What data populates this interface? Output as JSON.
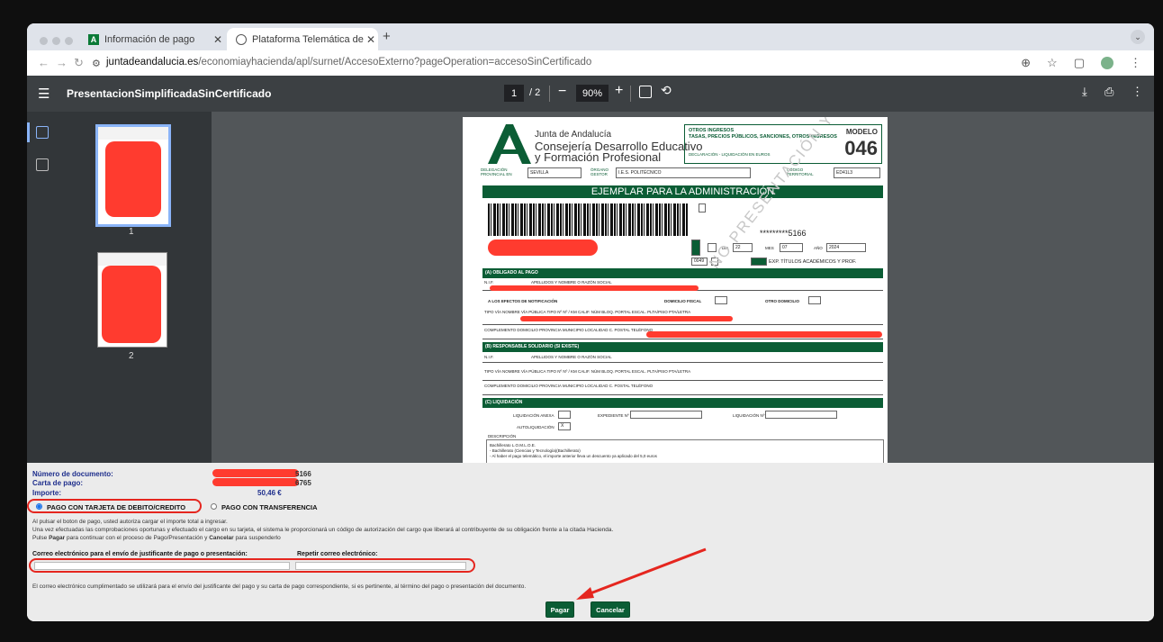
{
  "browser": {
    "tabs": [
      {
        "title": "Información de pago"
      },
      {
        "title": "Plataforma Telemática de Pa"
      }
    ],
    "url_host": "juntadeandalucia.es",
    "url_path": "/economiayhacienda/apl/surnet/AccesoExterno?pageOperation=accesoSinCertificado"
  },
  "pdf": {
    "title": "PresentacionSimplificadaSinCertificado",
    "current_page": "1",
    "total_pages": "/ 2",
    "zoom": "90%",
    "thumbnails": [
      {
        "label": "1"
      },
      {
        "label": "2"
      }
    ]
  },
  "document": {
    "org": "Junta de Andalucía",
    "dept": "Consejería Desarrollo Educativo y Formación Profesional",
    "category": "OTROS INGRESOS",
    "category_sub": "TASAS, PRECIOS PÚBLICOS, SANCIONES, OTROS INGRESOS",
    "modelo_label": "MODELO",
    "modelo_number": "046",
    "declaration": "DECLARACIÓN - LIQUIDACIÓN EN EUROS",
    "delegacion_label": "DELEGACIÓN PROVINCIAL EN",
    "delegacion_value": "SEVILLA",
    "organo_label": "ÓRGANO GESTOR",
    "organo_value": "I.E.S. POLITÉCNICO",
    "codigo_label": "CÓDIGO TERRITORIAL",
    "codigo_value": "ED41L3",
    "banner": "EJEMPLAR PARA LA ADMINISTRACIÓN",
    "doc_number": "*********5166",
    "date_day_label": "DIA",
    "date_day": "22",
    "date_month_label": "MES",
    "date_month": "07",
    "date_year_label": "AÑO",
    "date_year": "2024",
    "concept_code": "0049",
    "concept_text": "EXP. TÍTULOS ACADÉMICOS Y PROF.",
    "section_a": "(A) OBLIGADO AL PAGO",
    "nif_label": "N.I.F.",
    "name_label": "APELLIDOS Y NOMBRE O RAZÓN SOCIAL",
    "notif_label": "A LOS EFECTOS DE NOTIFICACIÓN",
    "domicilio_fiscal": "DOMICILIO FISCAL",
    "otro_domicilio": "OTRO DOMICILIO",
    "address_labels": "TIPO VÍA   NOMBRE VÍA PÚBLICA                                   TIPO Nº  Nº / KM  CALIF. NÚM  BLOQ.  PORTAL  ESCAL.  PLTA/PISO  PTA/LETRA",
    "address_labels2": "COMPLEMENTO DOMICILIO                 PROVINCIA      MUNICIPIO                          LOCALIDAD                   C. POSTAL   TELÉFONO",
    "section_b": "(B) RESPONSABLE SOLIDARIO (SI EXISTE)",
    "section_c": "(C) LIQUIDACIÓN",
    "liq_label": "LIQUIDACIÓN ANEXA",
    "exp_label": "EXPEDIENTE Nº",
    "liq_n_label": "LIQUIDACIÓN Nº",
    "auto_label": "AUTOLIQUIDACIÓN",
    "desc_label": "DESCRIPCIÓN",
    "desc_lines": [
      "Bachillerato L.O.M.L.O.E.",
      "  - Bachillerato (Ciencias y Tecnología)(Bachillerato)",
      "  - Al haber el pago telemático, el importe anterior lleva un descuento ya aplicado del 5,0 euros"
    ],
    "watermark": "NO PRESENTACIÓN Y DOCUMENTACIÓN"
  },
  "form": {
    "doc_number_label": "Número de documento:",
    "doc_number_value": "5166",
    "carta_label": "Carta de pago:",
    "carta_value": "6765",
    "importe_label": "Importe:",
    "importe_value": "50,46 €",
    "option_card": "PAGO CON TARJETA DE DEBITO/CREDITO",
    "option_transfer": "PAGO CON TRANSFERENCIA",
    "info_lines": [
      "Al pulsar el boton de pago, usted autoriza cargar el importe total a ingresar.",
      "Una vez efectuadas las comprobaciones oportunas y efectuado el cargo en su tarjeta, el sistema le proporcionará un código de autorización del cargo que liberará al contribuyente de su obligación frente a la citada Hacienda."
    ],
    "hint_prefix": "Pulse ",
    "hint_pagar": "Pagar",
    "hint_mid": " para continuar con el proceso de Pago/Presentación y ",
    "hint_cancelar": "Cancelar",
    "hint_suffix": " para suspenderlo",
    "email_label": "Correo electrónico para el envío de justificante de pago o presentación:",
    "email_repeat_label": "Repetir correo electrónico:",
    "email_value": "",
    "email_repeat_value": "",
    "email_note": "El correo electrónico cumplimentado se utilizará para el envío del justificante del pago y su carta de pago correspondiente, si es pertinente, al término del pago o presentación del documento.",
    "pay_button": "Pagar",
    "cancel_button": "Cancelar"
  },
  "colors": {
    "junta_green": "#0b5d35",
    "redaction": "#ff3b2f",
    "annotation_red": "#e5261f",
    "label_blue": "#1e2e8c"
  }
}
